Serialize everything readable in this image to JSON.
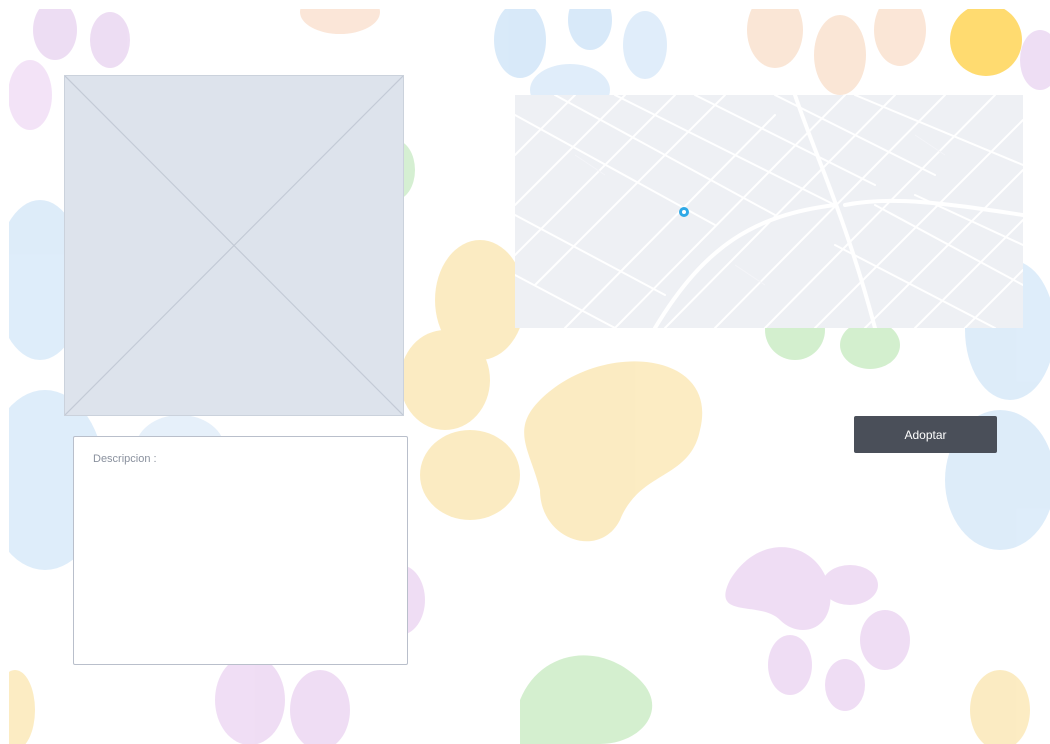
{
  "description": {
    "label": "Descripcion :"
  },
  "adopt_button": {
    "label": "Adoptar"
  },
  "colors": {
    "button_bg": "#4a4f59",
    "placeholder_bg": "#dde3ec",
    "map_bg": "#eef0f4",
    "map_pin": "#2ea8e6"
  },
  "icons": {
    "map_pin": "location-pin-icon",
    "image_placeholder": "image-placeholder-icon"
  }
}
